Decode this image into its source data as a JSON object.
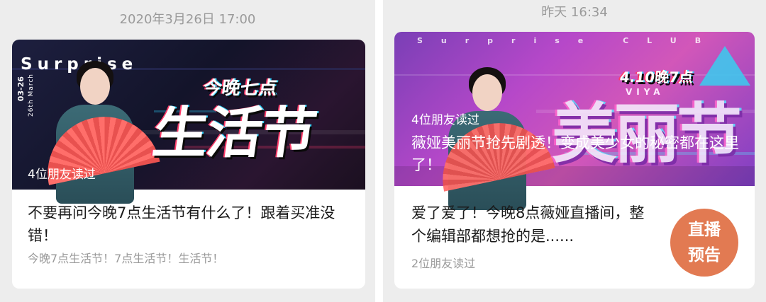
{
  "left_message": {
    "timestamp": "2020年3月26日 17:00",
    "banner": {
      "brand": "Surprise",
      "vertical_date": "03-26",
      "vertical_small": "26th March",
      "kicker": "今晚七点",
      "headline": "生活节",
      "read_count": "4位朋友读过"
    },
    "title": "不要再问今晚7点生活节有什么了！跟着买准没错！",
    "summary": "今晚7点生活节！7点生活节！生活节！"
  },
  "right_message": {
    "timestamp": "昨天 16:34",
    "banner": {
      "brand": "Surprise CLUB",
      "kicker": "4.10晚7点",
      "tag": "VIYA",
      "headline": "美丽节",
      "read_count": "4位朋友读过",
      "title": "薇娅美丽节抢先剧透！变成美少女的秘密都在这里了！"
    },
    "title": "爱了爱了！今晚8点薇娅直播间，整个编辑部都想抢的是......",
    "read_count": "2位朋友读过",
    "badge": {
      "line1": "直播",
      "line2": "预告"
    }
  },
  "colors": {
    "background": "#ededed",
    "card": "#ffffff",
    "timestamp": "#9a9a9a",
    "badge": "#e27a52"
  }
}
